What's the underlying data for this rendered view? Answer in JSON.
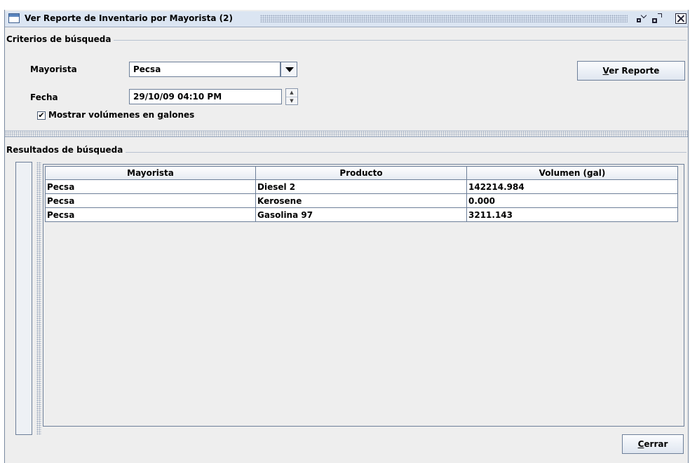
{
  "window": {
    "title": "Ver Reporte de Inventario por Mayorista (2)"
  },
  "criteria": {
    "group_title": "Criterios de búsqueda",
    "mayorista_label": "Mayorista",
    "mayorista_value": "Pecsa",
    "fecha_label": "Fecha",
    "fecha_value": "29/10/09 04:10 PM",
    "checkbox_label": "Mostrar volúmenes en galones",
    "checkbox_checked": true,
    "checkbox_mark": "✔",
    "report_button_label": "Ver Reporte"
  },
  "results": {
    "group_title": "Resultados de búsqueda",
    "columns": [
      "Mayorista",
      "Producto",
      "Volumen (gal)"
    ],
    "rows": [
      [
        "Pecsa",
        "Diesel 2",
        "142214.984"
      ],
      [
        "Pecsa",
        "Kerosene",
        "0.000"
      ],
      [
        "Pecsa",
        "Gasolina 97",
        "3211.143"
      ]
    ]
  },
  "footer": {
    "close_button_label": "Cerrar"
  },
  "icons": {
    "window": "window-icon",
    "minimize": "minimize-icon",
    "maximize": "maximize-icon",
    "close": "close-icon",
    "combo_arrow": "chevron-down-icon",
    "spinner": "spinner-icon"
  },
  "colors": {
    "titlebar": "#dbe5f2",
    "panel": "#eeeeee",
    "border": "#6d7f99"
  }
}
